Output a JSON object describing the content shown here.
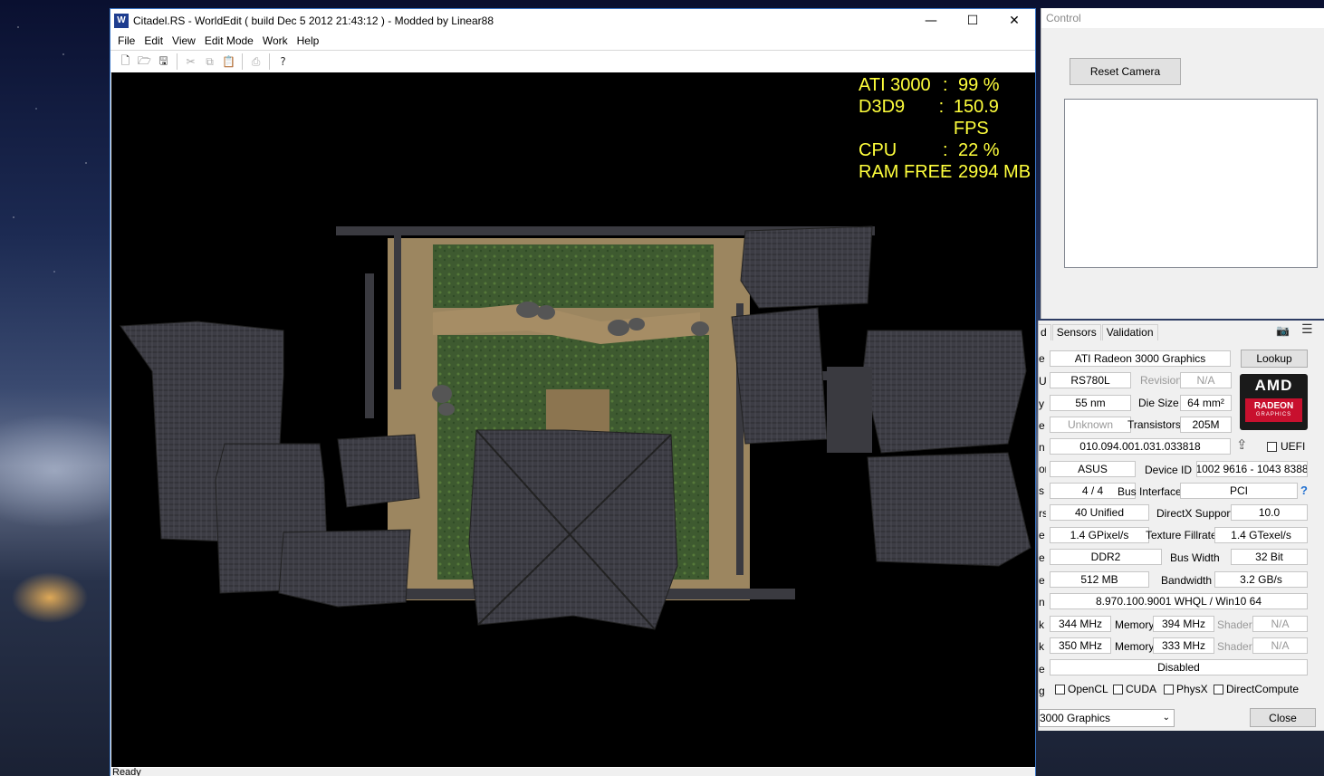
{
  "worldedit": {
    "title": "Citadel.RS - WorldEdit ( build Dec  5 2012 21:43:12 ) - Modded by Linear88",
    "menu": [
      "File",
      "Edit",
      "View",
      "Edit Mode",
      "Work",
      "Help"
    ],
    "window_controls": {
      "minimize": "—",
      "maximize": "☐",
      "close": "✕"
    },
    "toolbar_icons": [
      "new-file-icon",
      "open-folder-icon",
      "save-icon",
      "cut-icon",
      "copy-icon",
      "paste-icon",
      "print-icon",
      "help-pointer-icon"
    ],
    "stats": [
      {
        "name": "ATI 3000",
        "value": "99 %"
      },
      {
        "name": "D3D9",
        "value": "150.9 FPS"
      },
      {
        "name": "CPU",
        "value": "22 %"
      },
      {
        "name": "RAM FREE",
        "value": "2994 MB"
      }
    ],
    "status": "Ready"
  },
  "control": {
    "title": "Control",
    "reset_camera": "Reset Camera"
  },
  "gpuz": {
    "tabs": [
      "d",
      "Sensors",
      "Validation"
    ],
    "name": "ATI Radeon 3000 Graphics",
    "lookup": "Lookup",
    "gpu": "RS780L",
    "revision_label": "Revision",
    "revision": "N/A",
    "technology": "55 nm",
    "die_size_label": "Die Size",
    "die_size": "64 mm²",
    "release": "Unknown",
    "transistors_label": "Transistors",
    "transistors": "205M",
    "bios": "010.094.001.031.033818",
    "uefi_label": "UEFI",
    "subvendor": "ASUS",
    "device_id_label": "Device ID",
    "device_id": "1002 9616 - 1043 8388",
    "rops": "4 / 4",
    "bus_interface_label": "Bus Interface",
    "bus_interface": "PCI",
    "help": "?",
    "shaders": "40 Unified",
    "directx_label": "DirectX Support",
    "directx": "10.0",
    "pixel_fillrate": "1.4 GPixel/s",
    "texture_fillrate_label": "Texture Fillrate",
    "texture_fillrate": "1.4 GTexel/s",
    "memory_type": "DDR2",
    "bus_width_label": "Bus Width",
    "bus_width": "32 Bit",
    "memory_size": "512 MB",
    "bandwidth_label": "Bandwidth",
    "bandwidth": "3.2 GB/s",
    "driver": "8.970.100.9001 WHQL / Win10 64",
    "gpu_clock": "344 MHz",
    "memory_label": "Memory",
    "memory_clock": "394 MHz",
    "shader_label": "Shader",
    "shader_clock": "N/A",
    "default_clock": "350 MHz",
    "default_memory": "333 MHz",
    "default_shader": "N/A",
    "crossfire": "Disabled",
    "computing": [
      "OpenCL",
      "CUDA",
      "PhysX",
      "DirectCompute"
    ],
    "row_cut_labels": [
      "e",
      "U",
      "y",
      "e",
      "n",
      "or",
      "s",
      "rs",
      "e",
      "e",
      "e",
      "n",
      "k",
      "k",
      "e",
      "g"
    ],
    "selected_gpu": "3000 Graphics",
    "close": "Close",
    "logo": {
      "brand": "AMD",
      "line1": "RADEON",
      "line2": "GRAPHICS"
    }
  }
}
